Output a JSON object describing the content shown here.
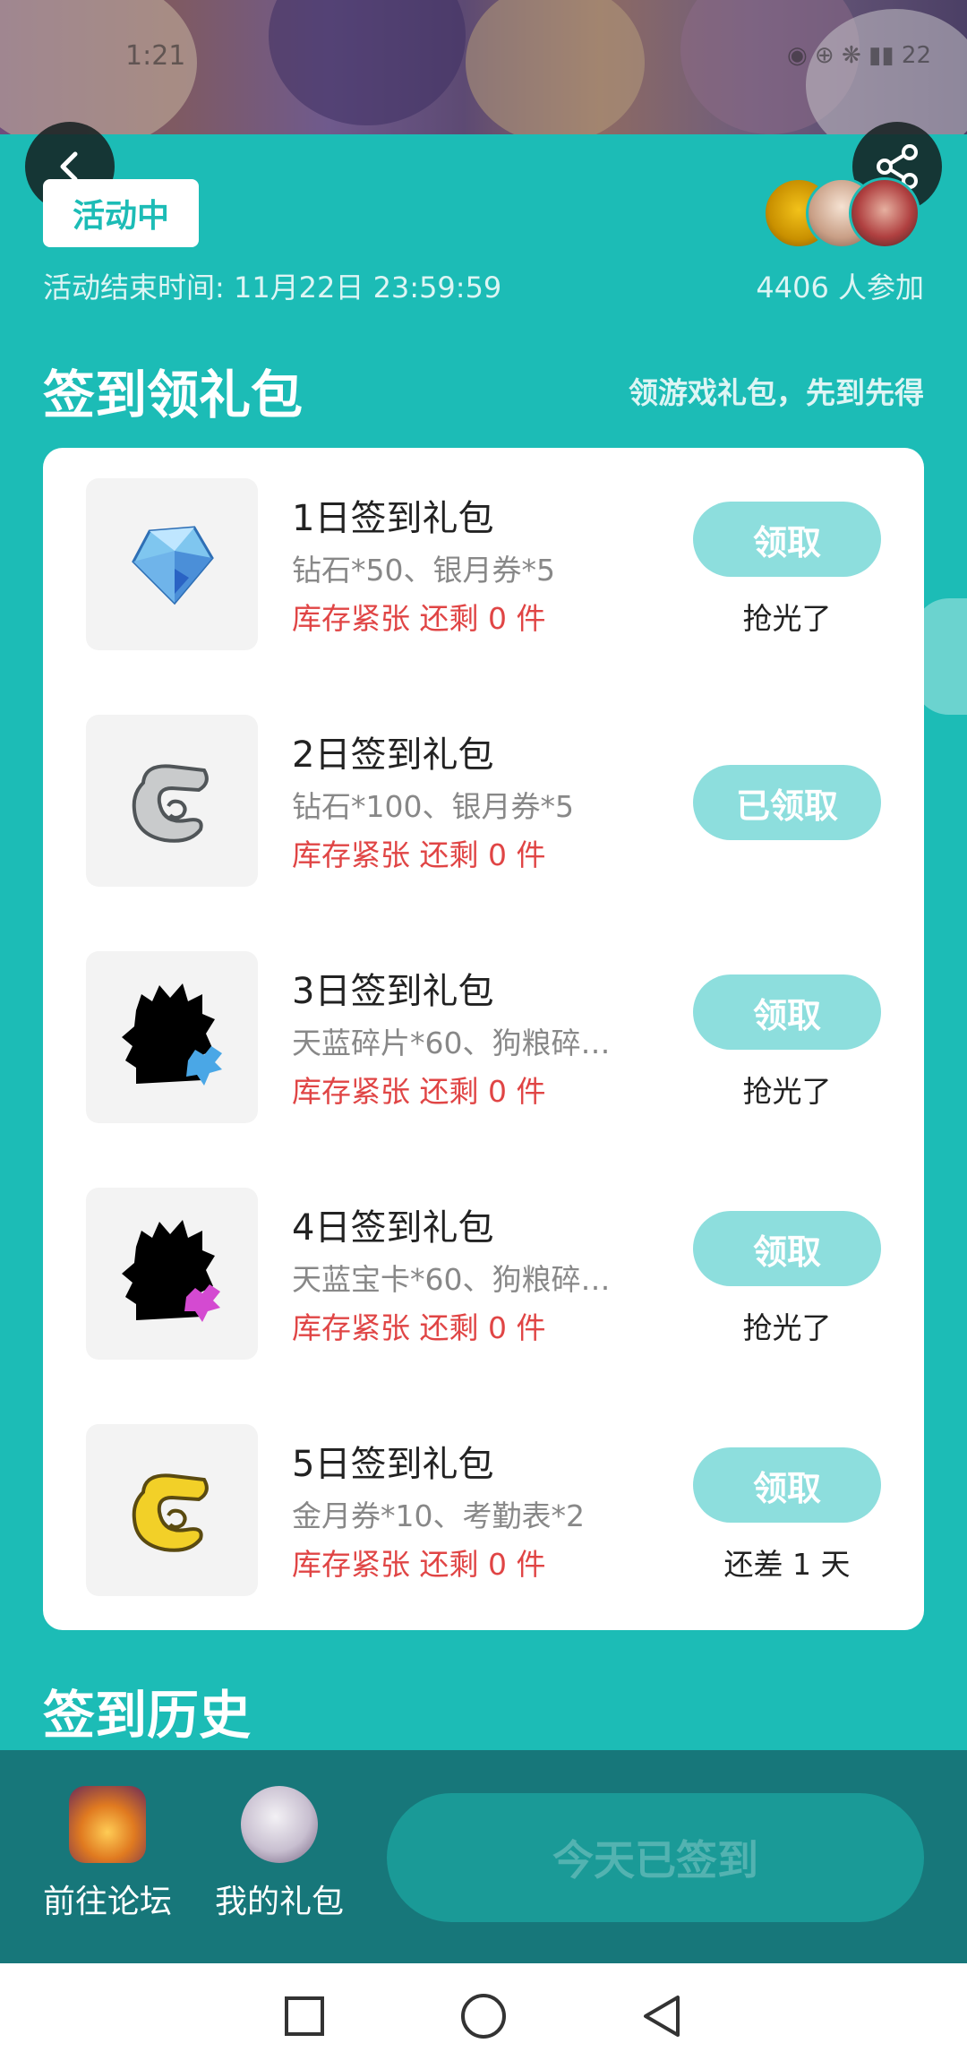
{
  "status_bar": {
    "time": "1:21",
    "icons": "◉ ⊕ ❋ ▮▮ 22"
  },
  "header": {
    "status_chip": "活动中",
    "end_time": "活动结束时间: 11月22日 23:59:59",
    "participants": "4406 人参加"
  },
  "signin": {
    "title": "签到领礼包",
    "subtitle": "领游戏礼包，先到先得",
    "items": [
      {
        "name": "1日签到礼包",
        "desc": "钻石*50、银月券*5",
        "stock": "库存紧张 还剩 0 件",
        "button": "领取",
        "note": "抢光了",
        "icon": "diamond-icon"
      },
      {
        "name": "2日签到礼包",
        "desc": "钻石*100、银月券*5",
        "stock": "库存紧张 还剩 0 件",
        "button": "已领取",
        "note": "",
        "icon": "silver-scroll-icon"
      },
      {
        "name": "3日签到礼包",
        "desc": "天蓝碎片*60、狗粮碎…",
        "stock": "库存紧张 还剩 0 件",
        "button": "领取",
        "note": "抢光了",
        "icon": "silhouette-blue-shard-icon"
      },
      {
        "name": "4日签到礼包",
        "desc": "天蓝宝卡*60、狗粮碎…",
        "stock": "库存紧张 还剩 0 件",
        "button": "领取",
        "note": "抢光了",
        "icon": "silhouette-pink-shard-icon"
      },
      {
        "name": "5日签到礼包",
        "desc": "金月券*10、考勤表*2",
        "stock": "库存紧张 还剩 0 件",
        "button": "领取",
        "note": "还差 1 天",
        "icon": "gold-scroll-icon"
      }
    ]
  },
  "history": {
    "title": "签到历史"
  },
  "bottom_bar": {
    "forum_label": "前往论坛",
    "gifts_label": "我的礼包",
    "checkin_label": "今天已签到"
  },
  "colors": {
    "accent": "#1cbcb6",
    "button_light": "#8ddedd",
    "stock_red": "#e04545",
    "bottom_bar": "#17777a"
  }
}
